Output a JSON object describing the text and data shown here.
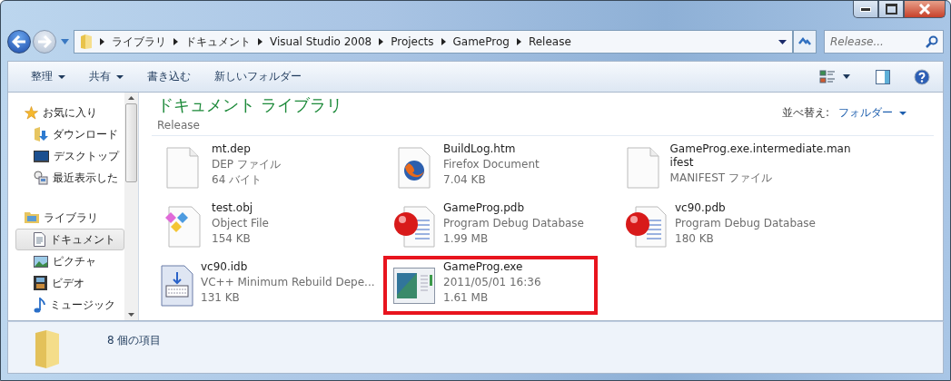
{
  "address_bar": {
    "crumbs": [
      "ライブラリ",
      "ドキュメント",
      "Visual Studio 2008",
      "Projects",
      "GameProg",
      "Release"
    ]
  },
  "search": {
    "placeholder": "Release..."
  },
  "toolbar": {
    "items": [
      {
        "label": "整理",
        "dropdown": true
      },
      {
        "label": "共有",
        "dropdown": true
      },
      {
        "label": "書き込む",
        "dropdown": false
      },
      {
        "label": "新しいフォルダー",
        "dropdown": false
      }
    ]
  },
  "sidebar": {
    "sections": [
      {
        "label": "お気に入り",
        "kind": "star",
        "children": [
          {
            "label": "ダウンロード",
            "kind": "download",
            "selected": false
          },
          {
            "label": "デスクトップ",
            "kind": "desktop",
            "selected": false
          },
          {
            "label": "最近表示した",
            "kind": "recent",
            "selected": false
          }
        ]
      },
      {
        "label": "ライブラリ",
        "kind": "library",
        "children": [
          {
            "label": "ドキュメント",
            "kind": "document",
            "selected": true
          },
          {
            "label": "ピクチャ",
            "kind": "picture",
            "selected": false
          },
          {
            "label": "ビデオ",
            "kind": "video",
            "selected": false
          },
          {
            "label": "ミュージック",
            "kind": "music",
            "selected": false
          }
        ]
      }
    ]
  },
  "library": {
    "title": "ドキュメント ライブラリ",
    "subtitle": "Release",
    "sort_label": "並べ替え:",
    "sort_value": "フォルダー"
  },
  "files": [
    {
      "name": "mt.dep",
      "type": "DEP ファイル",
      "size": "64 バイト",
      "kind": "blank",
      "highlighted": false
    },
    {
      "name": "BuildLog.htm",
      "type": "Firefox Document",
      "size": "7.04 KB",
      "kind": "firefox",
      "highlighted": false
    },
    {
      "name": "GameProg.exe.intermediate.manifest",
      "type": "MANIFEST ファイル",
      "kind": "blank",
      "highlighted": false
    },
    {
      "name": "test.obj",
      "type": "Object File",
      "size": "154 KB",
      "kind": "object",
      "highlighted": false
    },
    {
      "name": "GameProg.pdb",
      "type": "Program Debug Database",
      "size": "1.99 MB",
      "kind": "debug",
      "highlighted": false
    },
    {
      "name": "vc90.pdb",
      "type": "Program Debug Database",
      "size": "180 KB",
      "kind": "debug",
      "highlighted": false
    },
    {
      "name": "vc90.idb",
      "type": "VC++ Minimum Rebuild Depe...",
      "size": "131 KB",
      "kind": "idb",
      "highlighted": false
    },
    {
      "name": "GameProg.exe",
      "type": "2011/05/01 16:36",
      "size": "1.61 MB",
      "kind": "exe",
      "highlighted": true
    }
  ],
  "details": {
    "count": "8 個の項目"
  }
}
